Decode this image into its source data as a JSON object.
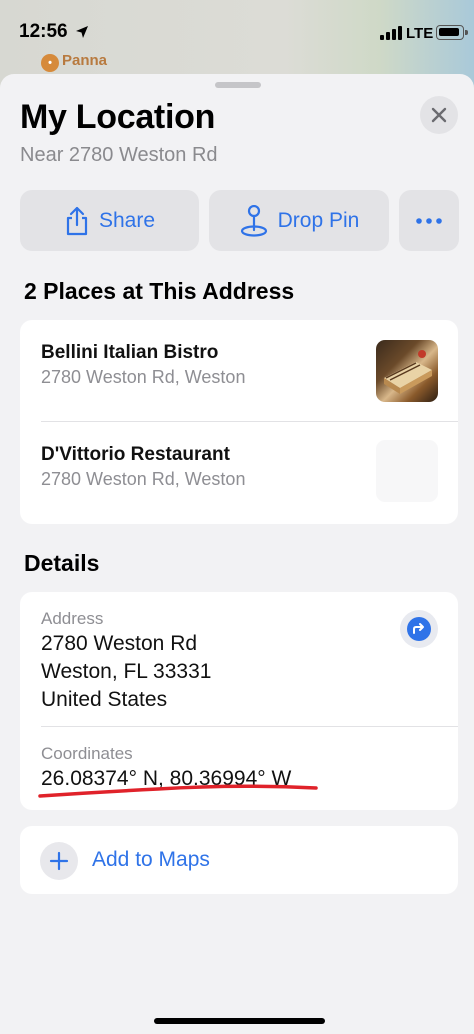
{
  "status_bar": {
    "time": "12:56",
    "network": "LTE"
  },
  "map": {
    "poi_label": "Panna"
  },
  "sheet": {
    "title": "My Location",
    "subtitle": "Near 2780 Weston Rd",
    "actions": {
      "share_label": "Share",
      "drop_pin_label": "Drop Pin",
      "more_label": "•••"
    },
    "places_heading": "2 Places at This Address",
    "places": [
      {
        "name": "Bellini Italian Bistro",
        "address": "2780 Weston Rd, Weston"
      },
      {
        "name": "D'Vittorio Restaurant",
        "address": "2780 Weston Rd, Weston"
      }
    ],
    "details_heading": "Details",
    "details": {
      "address_label": "Address",
      "address_lines": [
        "2780 Weston Rd",
        "Weston, FL  33331",
        "United States"
      ],
      "coordinates_label": "Coordinates",
      "coordinates_value": "26.08374° N, 80.36994° W"
    },
    "add_to_maps_label": "Add to Maps"
  },
  "colors": {
    "accent": "#2f73e8",
    "annotation": "#e0222a",
    "sheet_bg": "#f2f2f4"
  },
  "icons": [
    "location-arrow-icon",
    "signal-icon",
    "battery-icon",
    "close-icon",
    "share-icon",
    "drop-pin-icon",
    "more-icon",
    "directions-icon",
    "plus-icon"
  ]
}
